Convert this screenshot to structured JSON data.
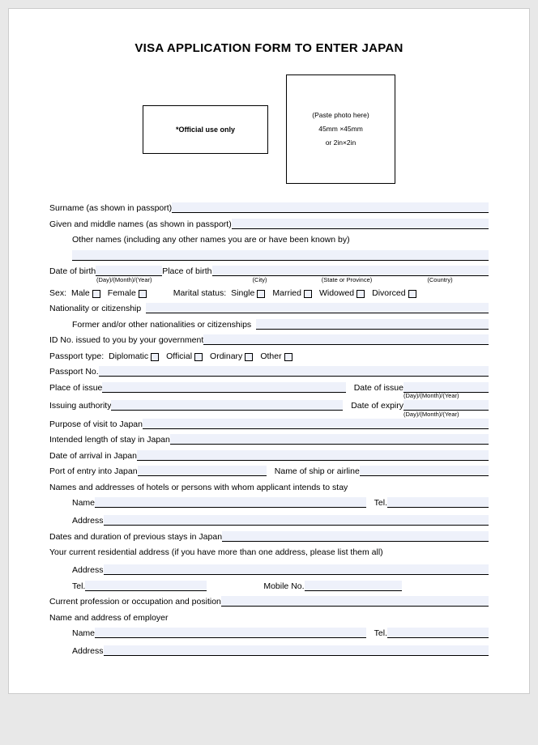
{
  "title": "VISA APPLICATION FORM TO ENTER JAPAN",
  "officialUse": "*Official use only",
  "photo": {
    "line1": "(Paste photo here)",
    "line2": "45mm ×45mm",
    "line3": "or 2in×2in"
  },
  "labels": {
    "surname": "Surname (as shown in passport)",
    "givenNames": "Given and middle names (as shown in passport)",
    "otherNames": "Other names (including any other names you are or have been known by)",
    "dob": "Date of birth",
    "pob": "Place of birth",
    "dmy": "(Day)/(Month)/(Year)",
    "city": "(City)",
    "stateProvince": "(State or Province)",
    "country": "(Country)",
    "sex": "Sex:",
    "male": "Male",
    "female": "Female",
    "maritalStatus": "Marital status:",
    "single": "Single",
    "married": "Married",
    "widowed": "Widowed",
    "divorced": "Divorced",
    "nationality": "Nationality or citizenship",
    "formerNationality": "Former and/or other nationalities or citizenships",
    "idNo": "ID No. issued to you by your government",
    "passportType": "Passport type:",
    "diplomatic": "Diplomatic",
    "official": "Official",
    "ordinary": "Ordinary",
    "other": "Other",
    "passportNo": "Passport No.",
    "placeIssue": "Place of issue",
    "dateIssue": "Date of issue",
    "issuingAuthority": "Issuing authority",
    "dateExpiry": "Date of expiry",
    "purpose": "Purpose of visit to Japan",
    "intendedLength": "Intended length of stay in Japan",
    "dateArrival": "Date of arrival in Japan",
    "portEntry": "Port of entry into Japan",
    "shipAirline": "Name of ship or airline",
    "hotelsPersons": "Names and addresses of hotels or persons with whom applicant intends to stay",
    "name": "Name",
    "tel": "Tel.",
    "address": "Address",
    "previousStays": "Dates and duration of previous stays in Japan",
    "currentAddress": "Your current residential address (if you have more than one address, please list them all)",
    "mobileNo": "Mobile No.",
    "profession": "Current profession or occupation and position",
    "employer": "Name and address of employer"
  }
}
